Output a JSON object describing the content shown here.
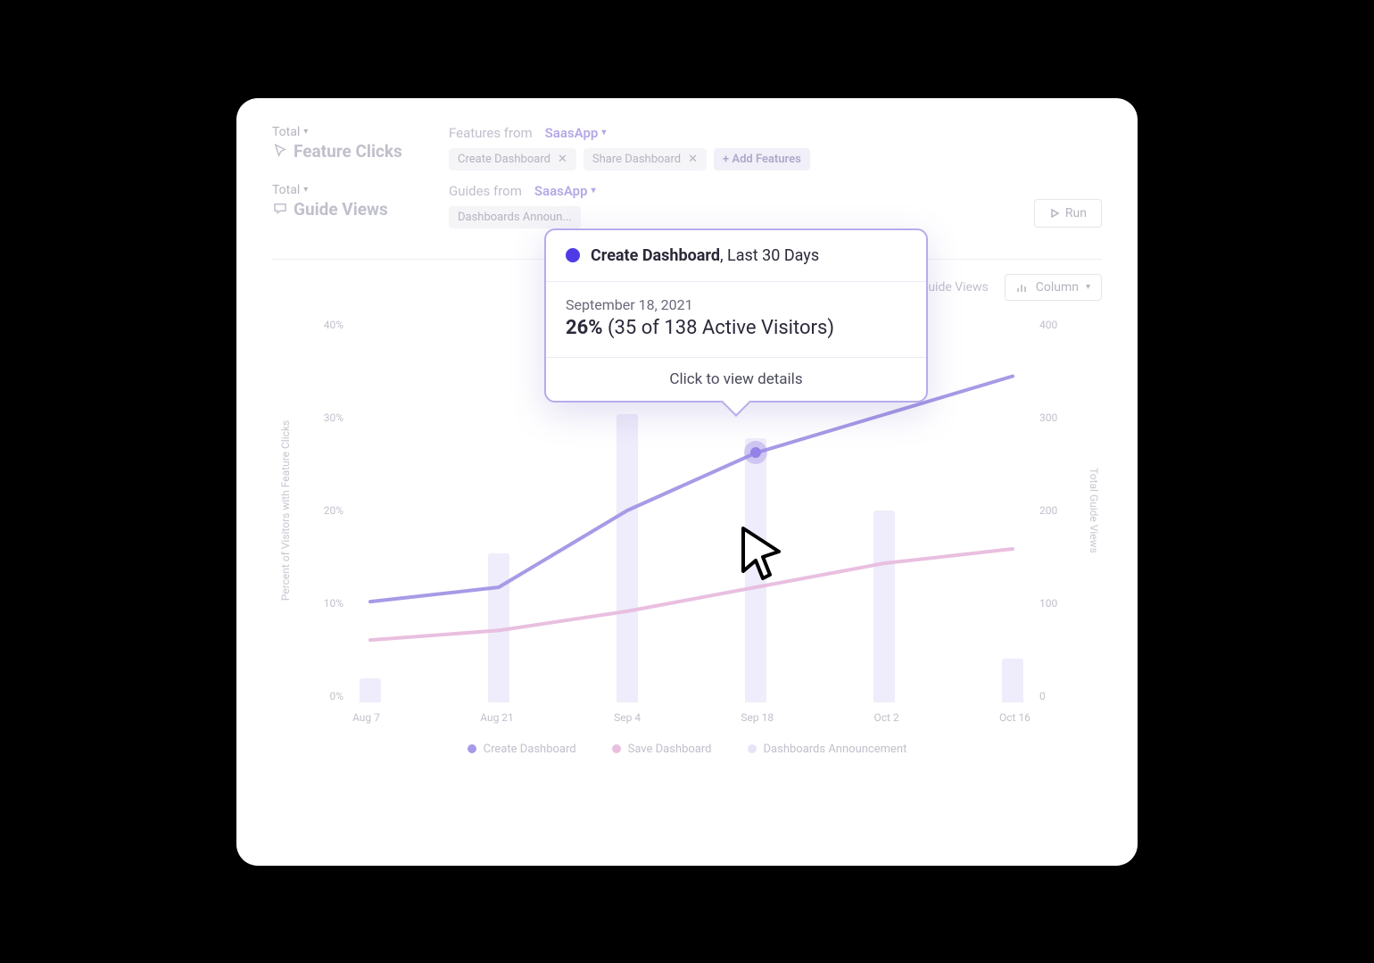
{
  "filters": {
    "features": {
      "total_label": "Total",
      "metric_label": "Feature Clicks",
      "from_label": "Features from",
      "app": "SaasApp",
      "chips": [
        {
          "label": "Create Dashboard"
        },
        {
          "label": "Share Dashboard"
        }
      ],
      "add_label": "+ Add Features"
    },
    "guides": {
      "total_label": "Total",
      "metric_label": "Guide Views",
      "from_label": "Guides from",
      "app": "SaasApp",
      "chips": [
        {
          "label": "Dashboards Announ..."
        }
      ]
    },
    "run_label": "Run"
  },
  "chart_controls": {
    "guide_views_label": "Guide Views",
    "column_label": "Column",
    "guide_views_color": "#e8e3fa"
  },
  "legend": {
    "items": [
      {
        "label": "Create Dashboard",
        "color": "#a79ae6"
      },
      {
        "label": "Save Dashboard",
        "color": "#e9bfe0"
      },
      {
        "label": "Dashboards Announcement",
        "color": "#e8e3fa"
      }
    ]
  },
  "tooltip": {
    "series": "Create Dashboard",
    "period": "Last 30 Days",
    "date": "September 18, 2021",
    "percent": "26%",
    "detail": "(35 of 138 Active Visitors)",
    "cta": "Click to view details"
  },
  "chart_data": {
    "type": "line",
    "categories": [
      "Aug 7",
      "Aug 21",
      "Sep 4",
      "Sep 18",
      "Oct 2",
      "Oct 16"
    ],
    "ylabel_left": "Percent of Visitors with Feature Clicks",
    "ylabel_right": "Total Guide Views",
    "ylim_left": [
      0,
      40
    ],
    "y_ticks_left": [
      "40%",
      "30%",
      "20%",
      "10%",
      "0%"
    ],
    "ylim_right": [
      0,
      400
    ],
    "y_ticks_right": [
      "400",
      "300",
      "200",
      "100",
      "0"
    ],
    "series": [
      {
        "name": "Create Dashboard",
        "values": [
          10.5,
          12,
          20,
          26,
          30,
          34
        ],
        "axis": "left"
      },
      {
        "name": "Save Dashboard",
        "values": [
          6.5,
          7.5,
          9.5,
          12,
          14.5,
          16
        ],
        "axis": "left"
      }
    ],
    "bars": {
      "name": "Dashboards Announcement",
      "axis": "right",
      "values": [
        25,
        155,
        300,
        275,
        200,
        45
      ]
    }
  }
}
